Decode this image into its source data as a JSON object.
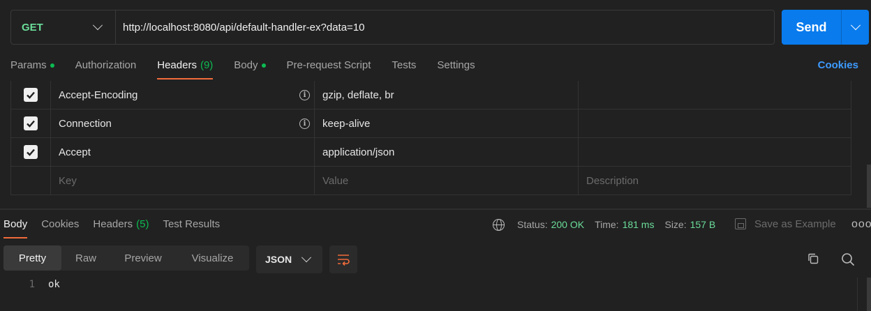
{
  "request": {
    "method": "GET",
    "url": "http://localhost:8080/api/default-handler-ex?data=10",
    "send_label": "Send"
  },
  "request_tabs": [
    {
      "label": "Params",
      "dot": true
    },
    {
      "label": "Authorization"
    },
    {
      "label": "Headers",
      "count": "(9)",
      "active": true
    },
    {
      "label": "Body",
      "dot": true
    },
    {
      "label": "Pre-request Script"
    },
    {
      "label": "Tests"
    },
    {
      "label": "Settings"
    }
  ],
  "cookies_link": "Cookies",
  "headers": {
    "rows": [
      {
        "key": "Accept-Encoding",
        "value": "gzip, deflate, br",
        "checked": true,
        "info": true
      },
      {
        "key": "Connection",
        "value": "keep-alive",
        "checked": true,
        "info": true
      },
      {
        "key": "Accept",
        "value": "application/json",
        "checked": true,
        "info": false
      }
    ],
    "placeholders": {
      "key": "Key",
      "value": "Value",
      "description": "Description"
    }
  },
  "response_tabs": [
    {
      "label": "Body",
      "active": true
    },
    {
      "label": "Cookies"
    },
    {
      "label": "Headers",
      "count": "(5)"
    },
    {
      "label": "Test Results"
    }
  ],
  "response_status": {
    "status_label": "Status:",
    "status_value": "200 OK",
    "time_label": "Time:",
    "time_value": "181 ms",
    "size_label": "Size:",
    "size_value": "157 B"
  },
  "save_example": "Save as Example",
  "more": "ooo",
  "view_modes": [
    "Pretty",
    "Raw",
    "Preview",
    "Visualize"
  ],
  "format": "JSON",
  "code": {
    "line_number": "1",
    "text": "ok"
  },
  "colors": {
    "accent": "#f26b3a",
    "send": "#097bed",
    "success": "#0cbb52",
    "method": "#6bdd9a",
    "link": "#3d9bff"
  }
}
